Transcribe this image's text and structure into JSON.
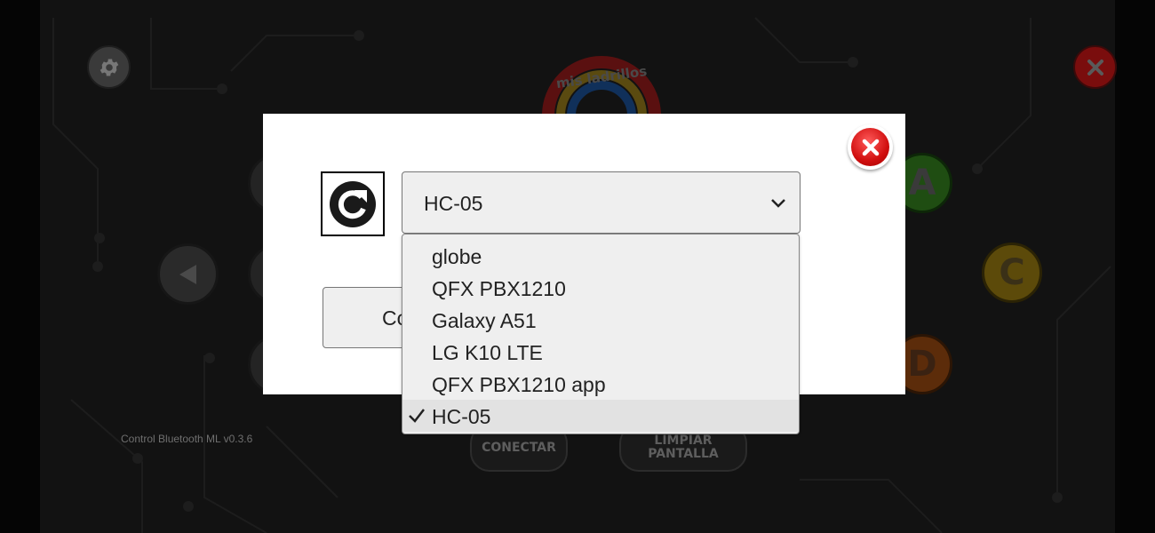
{
  "app": {
    "version": "Control Bluetooth ML v0.3.6",
    "logo_text": "mis ladrillos"
  },
  "background": {
    "buttons": {
      "a": "A",
      "c": "C",
      "d": "D",
      "conectar": "CONECTAR",
      "limpiar_line1": "LIMPIAR",
      "limpiar_line2": "PANTALLA"
    }
  },
  "dialog": {
    "selected_device": "HC-05",
    "connect_button_label": "Co",
    "options": [
      {
        "label": "globe",
        "selected": false
      },
      {
        "label": "QFX PBX1210",
        "selected": false
      },
      {
        "label": "Galaxy A51",
        "selected": false
      },
      {
        "label": "LG K10 LTE",
        "selected": false
      },
      {
        "label": "QFX PBX1210 app",
        "selected": false
      },
      {
        "label": "HC-05",
        "selected": true
      }
    ]
  },
  "colors": {
    "modal_bg": "#ffffff",
    "close_red": "#d10f0f",
    "dropdown_bg": "#efefef",
    "selected_option_bg": "#e2e2e2"
  },
  "icons": [
    "gear-icon",
    "close-icon",
    "refresh-icon",
    "chevron-down-icon",
    "check-icon",
    "arrow-left-icon"
  ]
}
